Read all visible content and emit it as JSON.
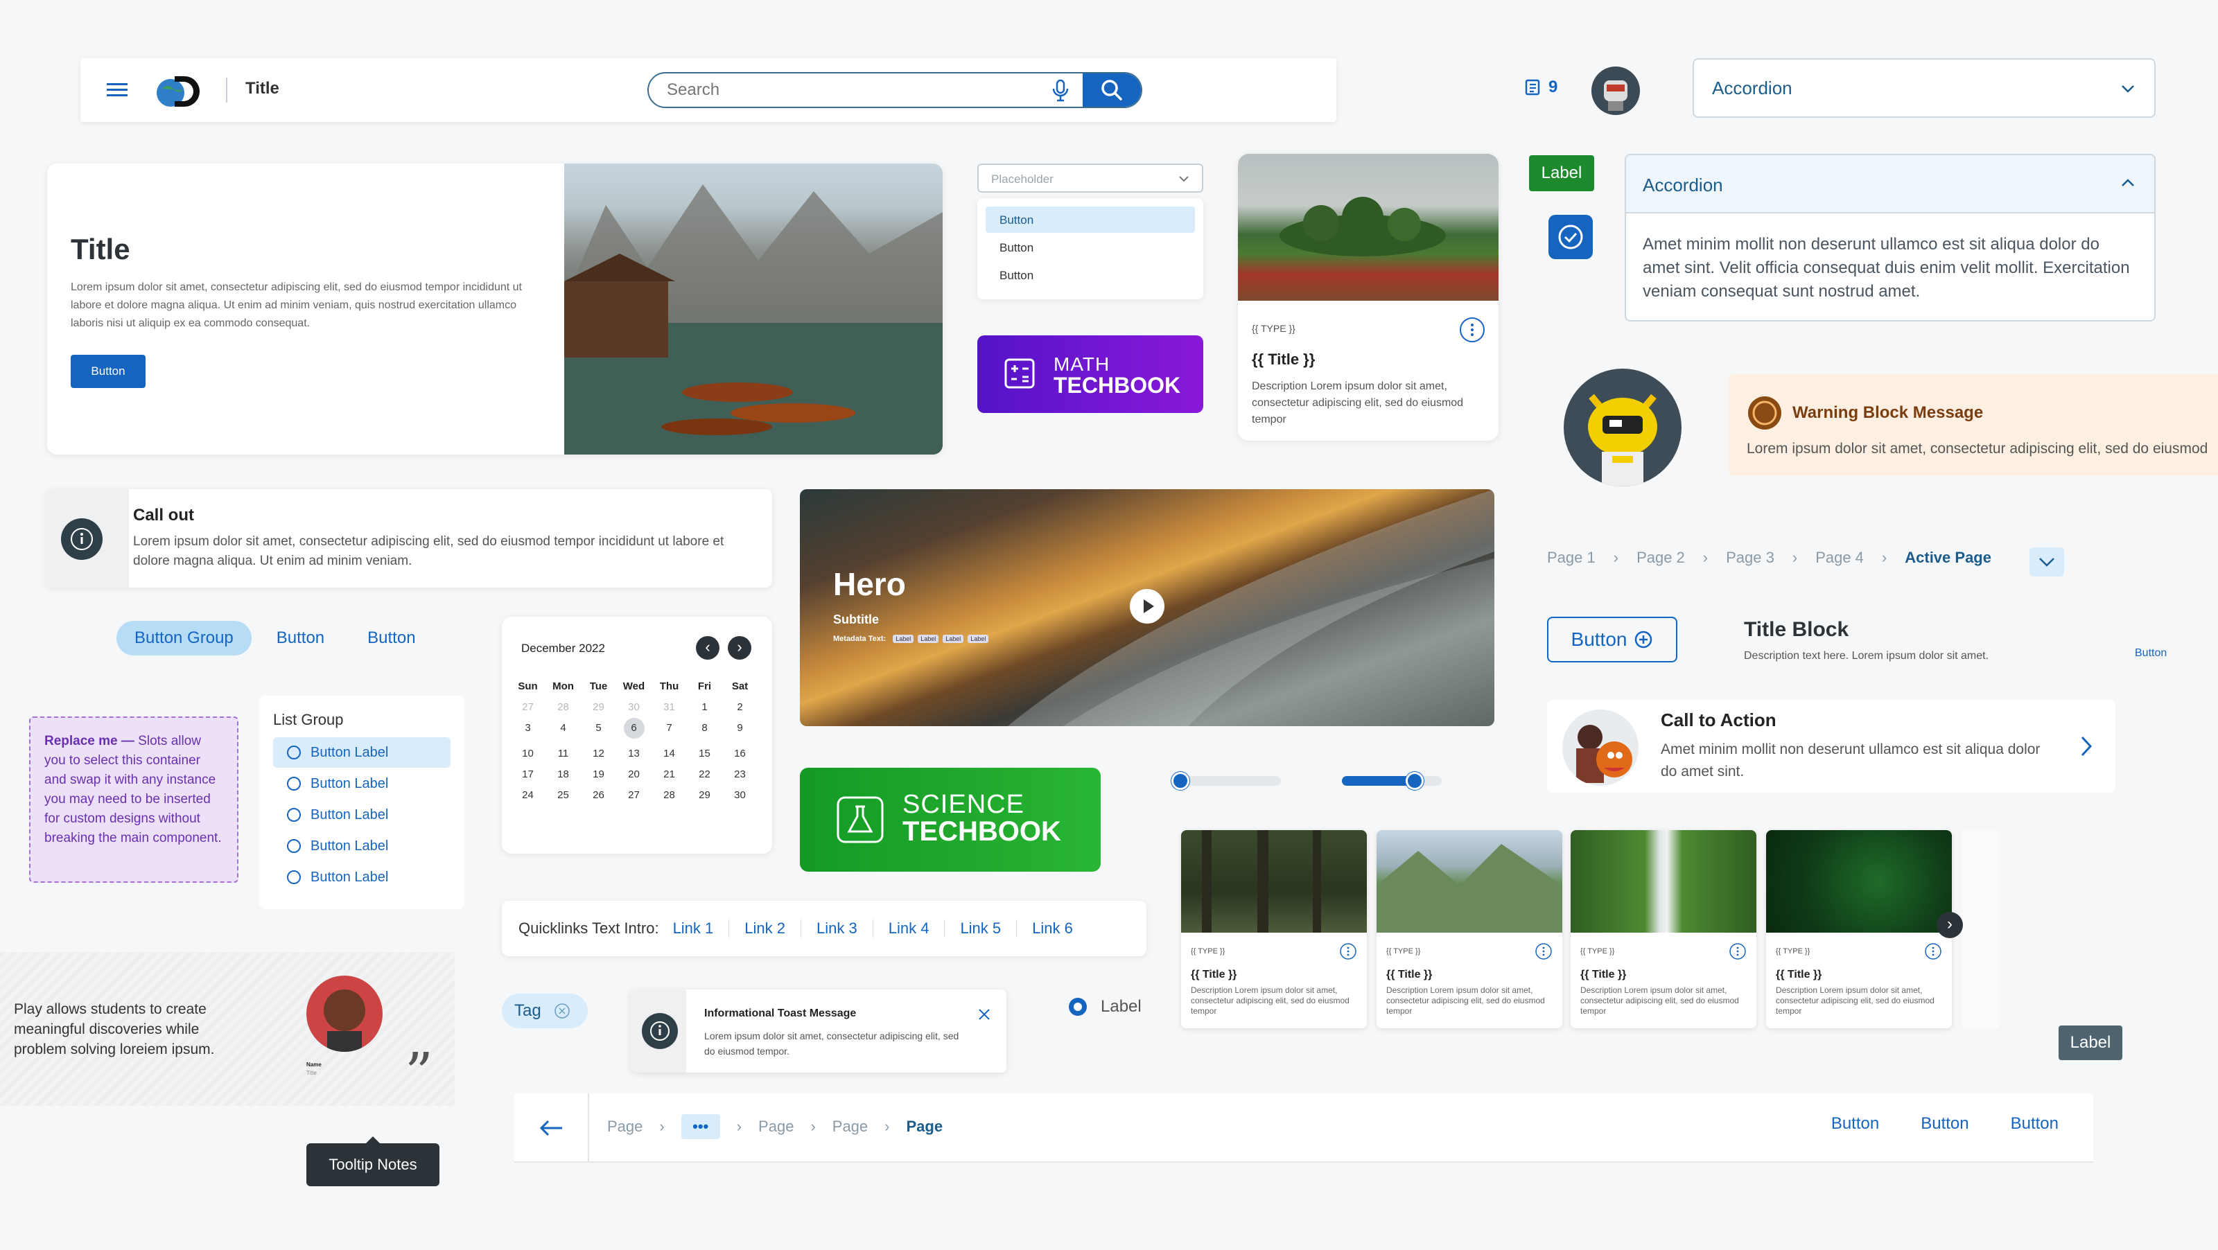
{
  "header": {
    "title": "Title",
    "search_placeholder": "Search",
    "notification_count": "9"
  },
  "accordion_collapsed": {
    "title": "Accordion"
  },
  "accordion_expanded": {
    "title": "Accordion",
    "body": "Amet minim mollit non deserunt ullamco est sit aliqua dolor do amet sint. Velit officia consequat duis enim velit mollit. Exercitation veniam consequat sunt nostrud amet."
  },
  "hero_card": {
    "title": "Title",
    "body": "Lorem ipsum dolor sit amet, consectetur adipiscing elit, sed do eiusmod tempor incididunt ut labore et dolore magna aliqua. Ut enim ad minim veniam, quis nostrud exercitation ullamco laboris nisi ut aliquip ex ea commodo consequat.",
    "button": "Button"
  },
  "dropdown": {
    "placeholder": "Placeholder",
    "options": [
      "Button",
      "Button",
      "Button"
    ]
  },
  "math_logo": {
    "line1": "MATH",
    "line2": "TECHBOOK"
  },
  "science_logo": {
    "line1": "SCIENCE",
    "line2": "TECHBOOK"
  },
  "content_card": {
    "type": "{{ TYPE }}",
    "title": "{{ Title }}",
    "desc": "Description Lorem ipsum dolor sit amet, consectetur adipiscing elit, sed do eiusmod tempor"
  },
  "label_green": "Label",
  "warning": {
    "title": "Warning Block Message",
    "body": "Lorem ipsum dolor sit amet, consectetur adipiscing elit, sed do eiusmod"
  },
  "callout": {
    "title": "Call out",
    "body": "Lorem ipsum dolor sit amet, consectetur adipiscing elit, sed do eiusmod tempor incididunt ut labore et dolore magna aliqua. Ut enim ad minim veniam."
  },
  "hero": {
    "title": "Hero",
    "subtitle": "Subtitle",
    "metadata_label": "Metadata Text:",
    "tags": [
      "Label",
      "Label",
      "Label",
      "Label"
    ]
  },
  "breadcrumb_top": {
    "pages": [
      "Page 1",
      "Page 2",
      "Page 3",
      "Page 4"
    ],
    "active": "Active Page"
  },
  "button_group": {
    "items": [
      "Button Group",
      "Button",
      "Button"
    ]
  },
  "calendar": {
    "month": "December 2022",
    "days": [
      "Sun",
      "Mon",
      "Tue",
      "Wed",
      "Thu",
      "Fri",
      "Sat"
    ],
    "weeks": [
      [
        "27",
        "28",
        "29",
        "30",
        "31",
        "1",
        "2"
      ],
      [
        "3",
        "4",
        "5",
        "6",
        "7",
        "8",
        "9"
      ],
      [
        "10",
        "11",
        "12",
        "13",
        "14",
        "15",
        "16"
      ],
      [
        "17",
        "18",
        "19",
        "20",
        "21",
        "22",
        "23"
      ],
      [
        "24",
        "25",
        "26",
        "27",
        "28",
        "29",
        "30"
      ]
    ],
    "selected": "6"
  },
  "icon_button": {
    "label": "Button"
  },
  "title_block": {
    "title": "Title Block",
    "desc": "Description text here. Lorem ipsum dolor sit amet.",
    "link": "Button"
  },
  "cta": {
    "title": "Call to Action",
    "body": "Amet minim mollit non deserunt ullamco est sit aliqua dolor do amet sint."
  },
  "slot": {
    "bold": "Replace me —",
    "body": " Slots allow you to select this container and swap it with any instance you may need to be inserted for custom designs without breaking the main component."
  },
  "list_group": {
    "title": "List Group",
    "items": [
      "Button Label",
      "Button Label",
      "Button Label",
      "Button Label",
      "Button Label"
    ]
  },
  "sliders": {
    "slider1_value": 0.0,
    "slider2_range": [
      0.0,
      0.72
    ]
  },
  "thumbnails": [
    {
      "type": "{{ TYPE }}",
      "title": "{{ Title }}",
      "desc": "Description Lorem ipsum dolor sit amet, consectetur adipiscing elit, sed do eiusmod tempor"
    },
    {
      "type": "{{ TYPE }}",
      "title": "{{ Title }}",
      "desc": "Description Lorem ipsum dolor sit amet, consectetur adipiscing elit, sed do eiusmod tempor"
    },
    {
      "type": "{{ TYPE }}",
      "title": "{{ Title }}",
      "desc": "Description Lorem ipsum dolor sit amet, consectetur adipiscing elit, sed do eiusmod tempor"
    },
    {
      "type": "{{ TYPE }}",
      "title": "{{ Title }}",
      "desc": "Description Lorem ipsum dolor sit amet, consectetur adipiscing elit, sed do eiusmod tempor"
    }
  ],
  "quicklinks": {
    "intro": "Quicklinks Text Intro:",
    "links": [
      "Link 1",
      "Link 2",
      "Link 3",
      "Link 4",
      "Link 5",
      "Link 6"
    ]
  },
  "quote": {
    "text": "Play allows students to create meaningful discoveries while problem solving loreiem ipsum.",
    "name": "Name",
    "role": "Title"
  },
  "tag": "Tag",
  "toast": {
    "title": "Informational Toast Message",
    "body": "Lorem ipsum dolor sit amet, consectetur adipiscing elit, sed do eiusmod tempor."
  },
  "radio_label": "Label",
  "label_dark": "Label",
  "tooltip": "Tooltip Notes",
  "bottom_bar": {
    "pages": [
      "Page",
      "Page",
      "Page"
    ],
    "active": "Page",
    "buttons": [
      "Button",
      "Button",
      "Button"
    ]
  },
  "colors": {
    "primary": "#1565c0",
    "green_label": "#1e8a2e",
    "warning_bg": "#fdf0e2",
    "warning_icon": "#8a4b12",
    "math": "#6a11cb",
    "science": "#1ea02c"
  }
}
